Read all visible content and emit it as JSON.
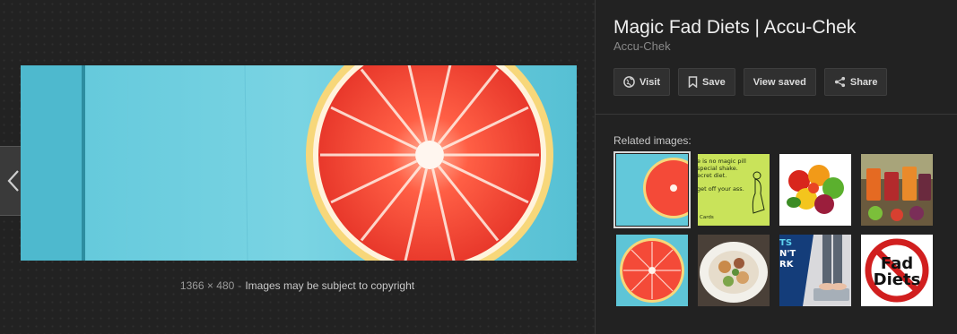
{
  "viewer": {
    "dimensions": "1366 × 480",
    "separator": "-",
    "copyright": "Images may be subject to copyright"
  },
  "panel": {
    "title": "Magic Fad Diets | Accu-Chek",
    "source": "Accu-Chek",
    "actions": {
      "visit": "Visit",
      "save": "Save",
      "view_saved": "View saved",
      "share": "Share"
    },
    "related_label": "Related images:",
    "related": {
      "t2_lines": [
        "e is no magic pill",
        "special shake.",
        "ecret diet.",
        "get off your ass.",
        "Cards"
      ],
      "t7_lines": [
        "TS",
        "N'T",
        "RK"
      ],
      "t8_lines": [
        "Fad",
        "Diets"
      ]
    }
  },
  "colors": {
    "accent_blue": "#4ec0d6",
    "grapefruit": "#f04a3a",
    "background": "#222222"
  }
}
